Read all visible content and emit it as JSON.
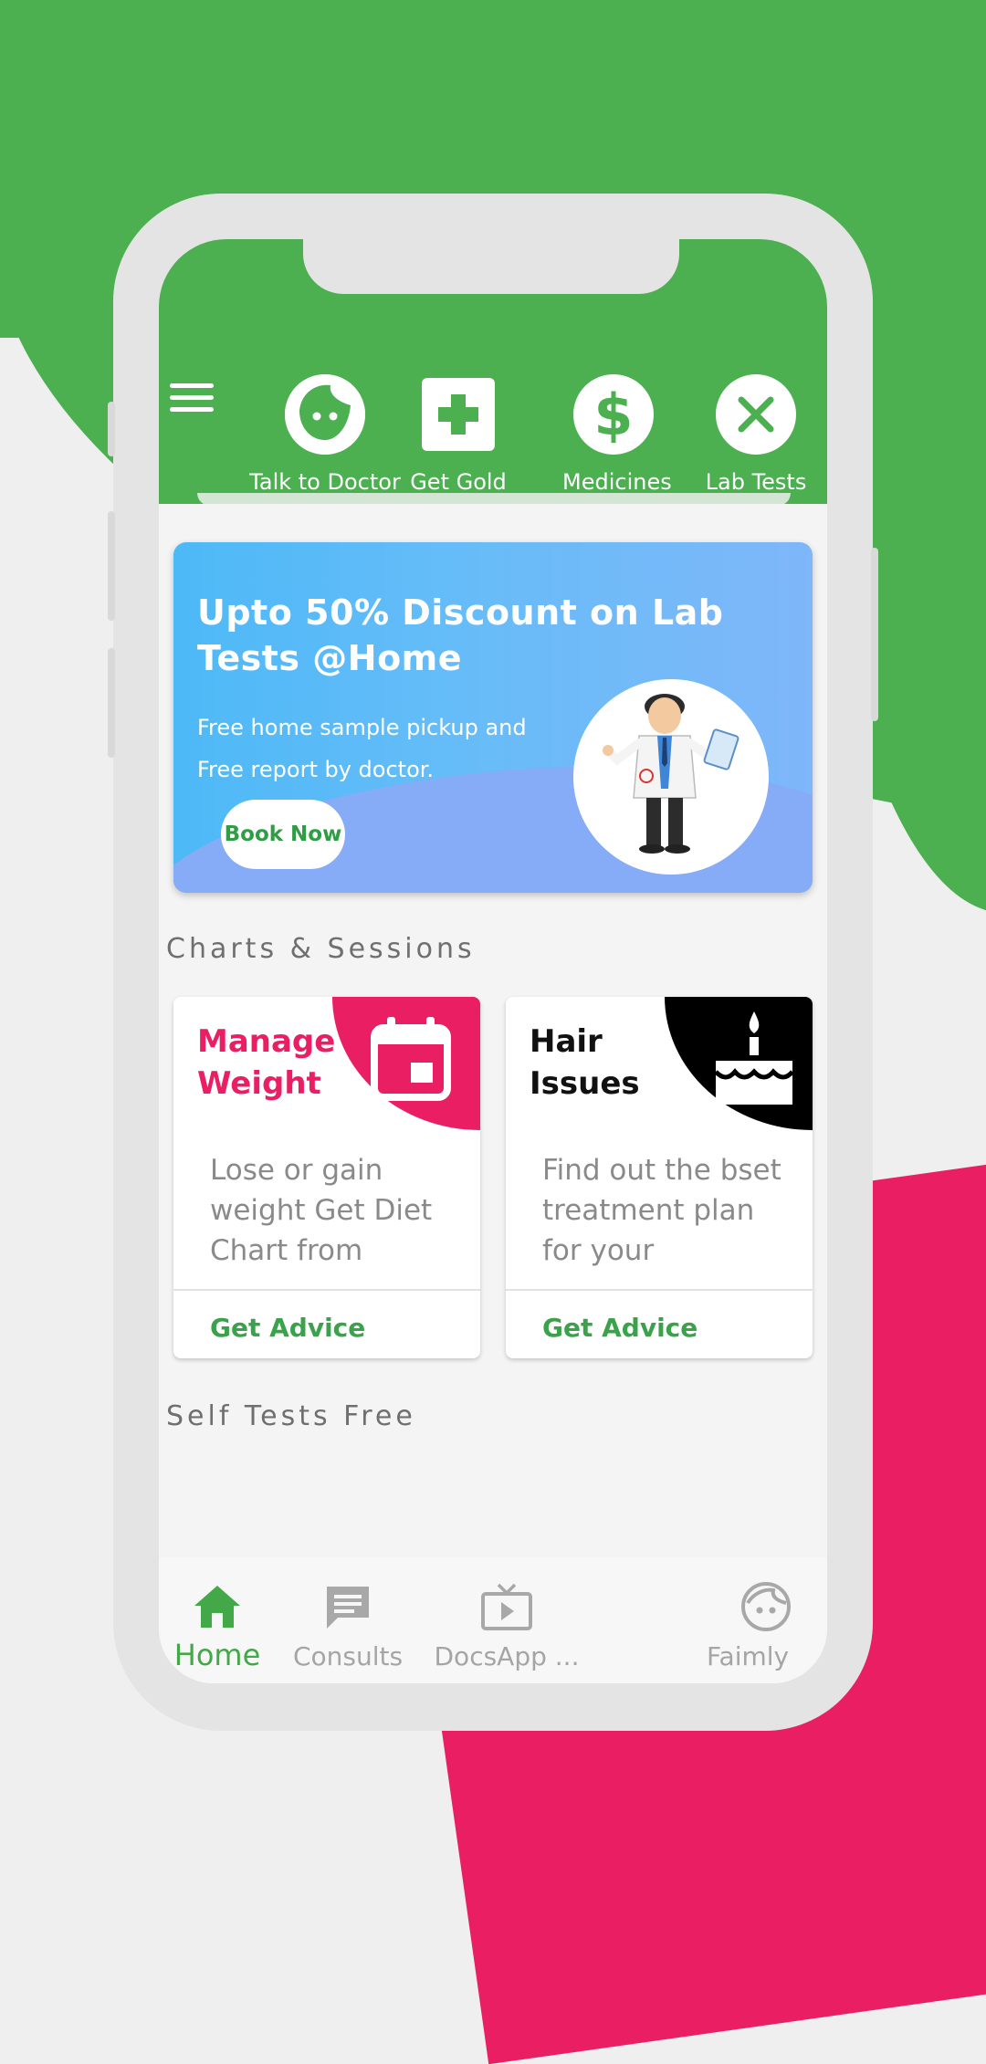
{
  "header": {
    "quick_actions": [
      {
        "label": "Talk to Doctor",
        "icon": "face-icon"
      },
      {
        "label": "Get Gold",
        "icon": "plus-icon"
      },
      {
        "label": "Medicines",
        "icon": "dollar-icon"
      },
      {
        "label": "Lab Tests",
        "icon": "close-icon"
      }
    ]
  },
  "banner": {
    "title": "Upto 50% Discount on Lab Tests @Home",
    "subtitle_line1": "Free home sample pickup and",
    "subtitle_line2": "Free report by doctor.",
    "cta": "Book Now"
  },
  "sections": {
    "charts_title": "Charts & Sessions",
    "self_tests_title": "Self Tests Free"
  },
  "cards": [
    {
      "title_line1": "Manage",
      "title_line2": "Weight",
      "description": "Lose or gain weight Get Diet Chart from",
      "action": "Get Advice",
      "accent": "#e91e63",
      "icon": "calendar-icon"
    },
    {
      "title_line1": "Hair",
      "title_line2": "Issues",
      "description": "Find out the bset treatment plan for your",
      "action": "Get Advice",
      "accent": "#000000",
      "icon": "cake-icon"
    }
  ],
  "bottom_nav": [
    {
      "label": "Home",
      "active": true
    },
    {
      "label": "Consults",
      "active": false
    },
    {
      "label": "DocsApp ...",
      "active": false
    },
    {
      "label": "Faimly",
      "active": false
    }
  ],
  "colors": {
    "primary_green": "#4caf50",
    "accent_pink": "#e91e63",
    "action_green": "#3aa24a"
  }
}
